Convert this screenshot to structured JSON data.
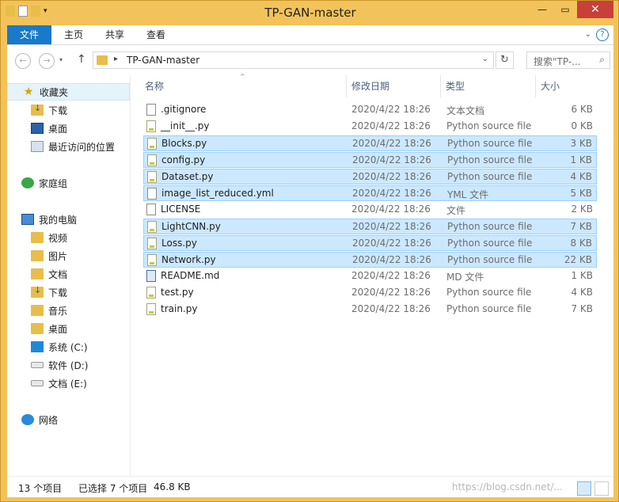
{
  "window": {
    "title": "TP-GAN-master"
  },
  "ribbon": {
    "tabs": [
      "文件",
      "主页",
      "共享",
      "查看"
    ]
  },
  "address": {
    "path": "TP-GAN-master",
    "search_placeholder": "搜索\"TP-..."
  },
  "sidebar": {
    "items": [
      {
        "label": "收藏夹",
        "icon": "star-icon"
      },
      {
        "label": "下载",
        "icon": "downloads-folder-icon"
      },
      {
        "label": "桌面",
        "icon": "desktop-icon"
      },
      {
        "label": "最近访问的位置",
        "icon": "recent-places-icon"
      },
      {
        "label": "家庭组",
        "icon": "homegroup-icon"
      },
      {
        "label": "我的电脑",
        "icon": "computer-icon"
      },
      {
        "label": "视频",
        "icon": "videos-folder-icon"
      },
      {
        "label": "图片",
        "icon": "pictures-folder-icon"
      },
      {
        "label": "文档",
        "icon": "documents-folder-icon"
      },
      {
        "label": "下载",
        "icon": "downloads-folder-icon"
      },
      {
        "label": "音乐",
        "icon": "music-folder-icon"
      },
      {
        "label": "桌面",
        "icon": "desktop-folder-icon"
      },
      {
        "label": "系统 (C:)",
        "icon": "windows-drive-icon"
      },
      {
        "label": "软件 (D:)",
        "icon": "drive-icon"
      },
      {
        "label": "文档 (E:)",
        "icon": "drive-icon"
      },
      {
        "label": "网络",
        "icon": "network-icon"
      }
    ]
  },
  "columns": {
    "name": "名称",
    "date": "修改日期",
    "type": "类型",
    "size": "大小"
  },
  "files": [
    {
      "name": ".gitignore",
      "date": "2020/4/22 18:26",
      "type": "文本文档",
      "size": "6 KB",
      "selected": false,
      "kind": "txt"
    },
    {
      "name": "__init__.py",
      "date": "2020/4/22 18:26",
      "type": "Python source file",
      "size": "0 KB",
      "selected": false,
      "kind": "py"
    },
    {
      "name": "Blocks.py",
      "date": "2020/4/22 18:26",
      "type": "Python source file",
      "size": "3 KB",
      "selected": true,
      "kind": "py"
    },
    {
      "name": "config.py",
      "date": "2020/4/22 18:26",
      "type": "Python source file",
      "size": "1 KB",
      "selected": true,
      "kind": "py"
    },
    {
      "name": "Dataset.py",
      "date": "2020/4/22 18:26",
      "type": "Python source file",
      "size": "4 KB",
      "selected": true,
      "kind": "py"
    },
    {
      "name": "image_list_reduced.yml",
      "date": "2020/4/22 18:26",
      "type": "YML 文件",
      "size": "5 KB",
      "selected": true,
      "kind": "txt"
    },
    {
      "name": "LICENSE",
      "date": "2020/4/22 18:26",
      "type": "文件",
      "size": "2 KB",
      "selected": false,
      "kind": "txt"
    },
    {
      "name": "LightCNN.py",
      "date": "2020/4/22 18:26",
      "type": "Python source file",
      "size": "7 KB",
      "selected": true,
      "kind": "py"
    },
    {
      "name": "Loss.py",
      "date": "2020/4/22 18:26",
      "type": "Python source file",
      "size": "8 KB",
      "selected": true,
      "kind": "py"
    },
    {
      "name": "Network.py",
      "date": "2020/4/22 18:26",
      "type": "Python source file",
      "size": "22 KB",
      "selected": true,
      "kind": "py"
    },
    {
      "name": "README.md",
      "date": "2020/4/22 18:26",
      "type": "MD 文件",
      "size": "1 KB",
      "selected": false,
      "kind": "md"
    },
    {
      "name": "test.py",
      "date": "2020/4/22 18:26",
      "type": "Python source file",
      "size": "4 KB",
      "selected": false,
      "kind": "py"
    },
    {
      "name": "train.py",
      "date": "2020/4/22 18:26",
      "type": "Python source file",
      "size": "7 KB",
      "selected": false,
      "kind": "py"
    }
  ],
  "status": {
    "count": "13 个项目",
    "selected": "已选择 7 个项目",
    "size": "46.8 KB"
  },
  "watermark": "https://blog.csdn.net/..."
}
